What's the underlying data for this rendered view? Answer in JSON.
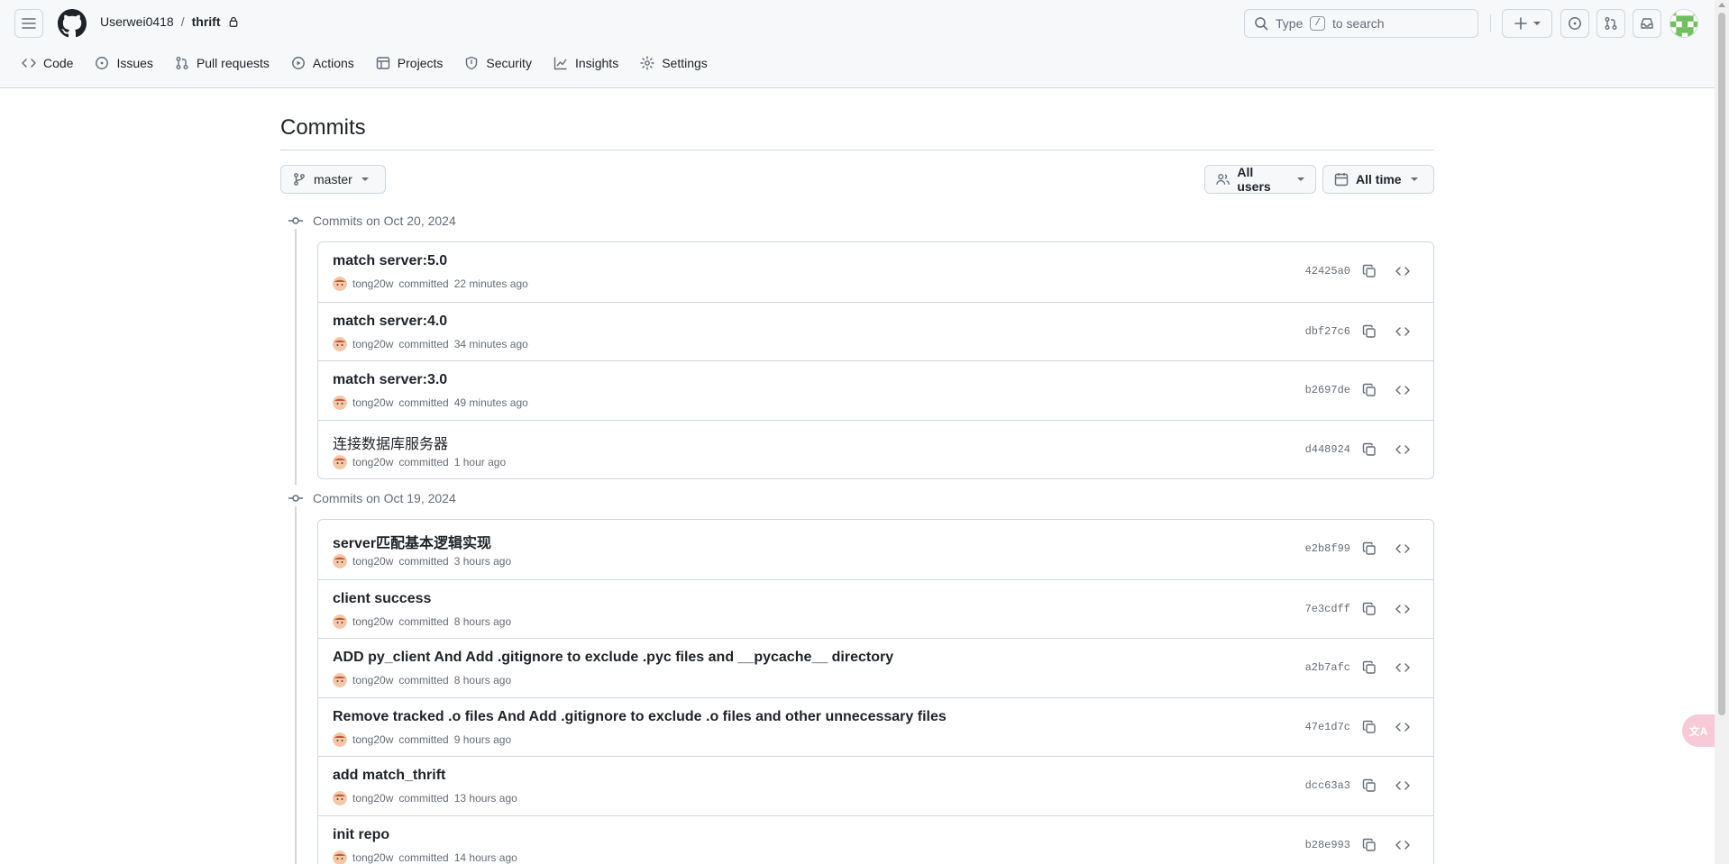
{
  "header": {
    "owner": "Userwei0418",
    "separator": "/",
    "repo": "thrift",
    "search_prefix": "Type",
    "search_key": "/",
    "search_suffix": "to search"
  },
  "nav": {
    "tabs": [
      {
        "label": "Code",
        "icon": "code-icon"
      },
      {
        "label": "Issues",
        "icon": "issue-icon"
      },
      {
        "label": "Pull requests",
        "icon": "pull-request-icon"
      },
      {
        "label": "Actions",
        "icon": "play-icon"
      },
      {
        "label": "Projects",
        "icon": "table-icon"
      },
      {
        "label": "Security",
        "icon": "shield-icon"
      },
      {
        "label": "Insights",
        "icon": "graph-icon"
      },
      {
        "label": "Settings",
        "icon": "gear-icon"
      }
    ]
  },
  "main": {
    "title": "Commits",
    "branch": "master",
    "users_filter": "All users",
    "time_filter": "All time"
  },
  "days": [
    {
      "heading": "Commits on Oct 20, 2024",
      "commits": [
        {
          "title": "match server:5.0",
          "author": "tong20w",
          "verb": "committed",
          "time": "22 minutes ago",
          "sha": "42425a0"
        },
        {
          "title": "match server:4.0",
          "author": "tong20w",
          "verb": "committed",
          "time": "34 minutes ago",
          "sha": "dbf27c6"
        },
        {
          "title": "match server:3.0",
          "author": "tong20w",
          "verb": "committed",
          "time": "49 minutes ago",
          "sha": "b2697de"
        },
        {
          "title": "连接数据库服务器",
          "author": "tong20w",
          "verb": "committed",
          "time": "1 hour ago",
          "sha": "d448924"
        }
      ]
    },
    {
      "heading": "Commits on Oct 19, 2024",
      "commits": [
        {
          "title": "server匹配基本逻辑实现",
          "author": "tong20w",
          "verb": "committed",
          "time": "3 hours ago",
          "sha": "e2b8f99"
        },
        {
          "title": "client success",
          "author": "tong20w",
          "verb": "committed",
          "time": "8 hours ago",
          "sha": "7e3cdff"
        },
        {
          "title": "ADD py_client And Add .gitignore to exclude .pyc files and __pycache__ directory",
          "author": "tong20w",
          "verb": "committed",
          "time": "8 hours ago",
          "sha": "a2b7afc"
        },
        {
          "title": "Remove tracked .o files And Add .gitignore to exclude .o files and other unnecessary files",
          "author": "tong20w",
          "verb": "committed",
          "time": "9 hours ago",
          "sha": "47e1d7c"
        },
        {
          "title": "add match_thrift",
          "author": "tong20w",
          "verb": "committed",
          "time": "13 hours ago",
          "sha": "dcc63a3"
        },
        {
          "title": "init repo",
          "author": "tong20w",
          "verb": "committed",
          "time": "14 hours ago",
          "sha": "b28e993"
        }
      ]
    }
  ],
  "floating": {
    "label": "文A"
  },
  "colors": {
    "accent": "#1f2328",
    "muted": "#656d76",
    "border": "#d0d7de",
    "avatar_green": "#6fbf5f"
  }
}
